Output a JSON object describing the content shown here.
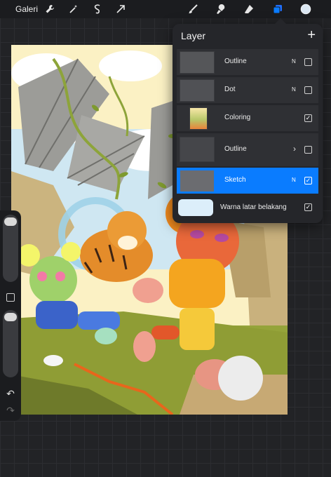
{
  "toolbar": {
    "gallery_label": "Galeri",
    "left_icons": [
      "wrench-icon",
      "magic-wand-icon",
      "selection-icon",
      "transform-arrow-icon"
    ],
    "right_icons": [
      "brush-icon",
      "smudge-icon",
      "eraser-icon",
      "layers-icon",
      "color-swatch-icon"
    ],
    "active_color": "#dbe7f3",
    "accent": "#0a7cff"
  },
  "layer_panel": {
    "title": "Layer",
    "add_icon": "+",
    "layers": [
      {
        "name": "Outline",
        "blend": "N",
        "visible": false,
        "active": false,
        "group": false
      },
      {
        "name": "Dot",
        "blend": "N",
        "visible": false,
        "active": false,
        "group": false
      },
      {
        "name": "Coloring",
        "blend": "",
        "visible": true,
        "active": false,
        "group": false
      },
      {
        "name": "Outline",
        "blend": "",
        "visible": false,
        "active": false,
        "group": true
      },
      {
        "name": "Sketch",
        "blend": "N",
        "visible": true,
        "active": true,
        "group": false
      }
    ],
    "background": {
      "label": "Warna latar belakang",
      "color": "#dceefa",
      "visible": true
    }
  },
  "sidebar": {
    "icons": [
      "size-slider",
      "modify-button-icon",
      "opacity-slider",
      "undo-icon",
      "redo-icon"
    ]
  }
}
